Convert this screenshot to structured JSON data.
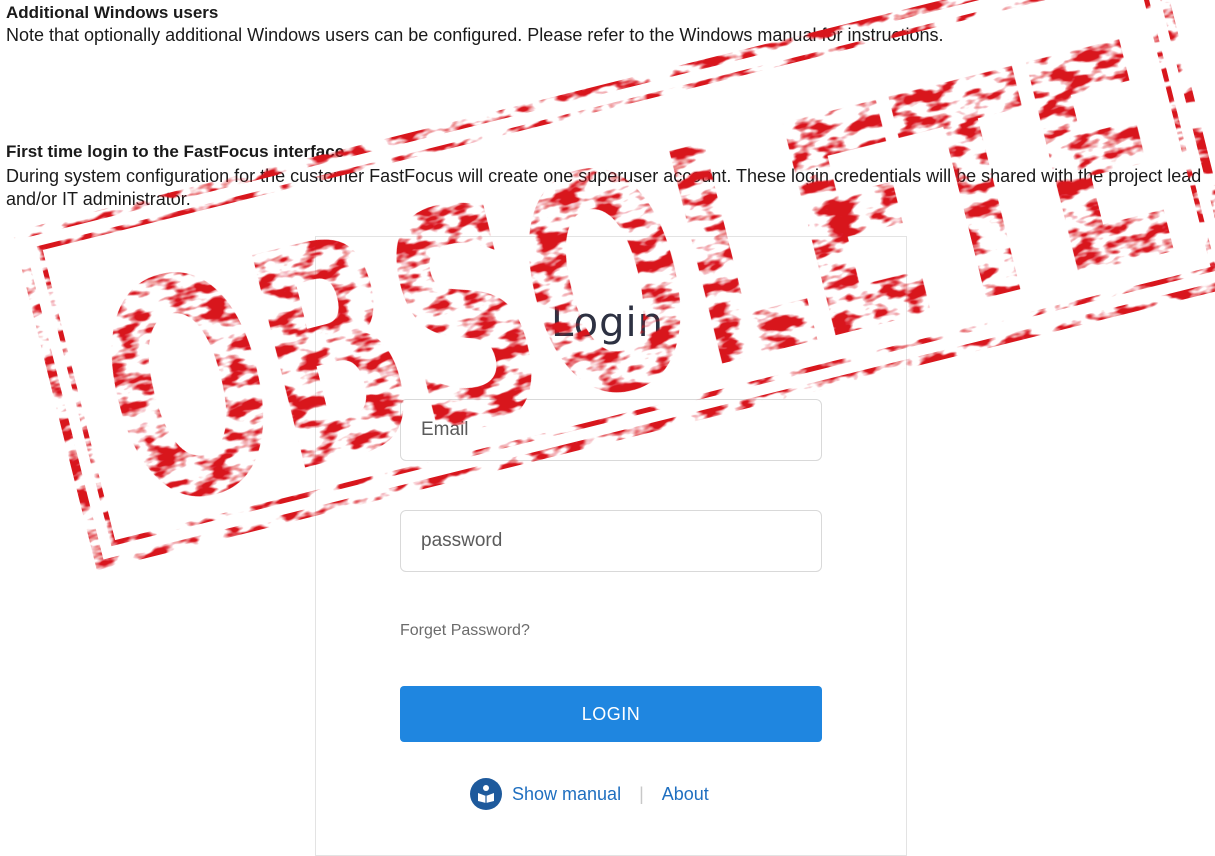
{
  "document": {
    "section1_heading": "Additional Windows users",
    "section1_text": "Note that optionally additional Windows users can be configured. Please refer to the Windows manual for instructions.",
    "section2_heading": "First time login to the FastFocus interface",
    "section2_text": "During system configuration for the customer FastFocus will create one superuser account. These login credentials will be shared with the project lead and/or IT administrator."
  },
  "login": {
    "title": "Login",
    "email_placeholder": "Email",
    "password_placeholder": "password",
    "forgot_label": "Forget Password?",
    "login_button": "LOGIN",
    "manual_link": "Show manual",
    "separator": "|",
    "about_link": "About"
  },
  "stamp": {
    "text": "OBSOLETE",
    "color": "#d8121b"
  },
  "colors": {
    "accent": "#1f86e0",
    "link": "#1f6fc0",
    "stamp_red": "#d8121b"
  },
  "icons": {
    "manual": "manual-book-icon"
  }
}
